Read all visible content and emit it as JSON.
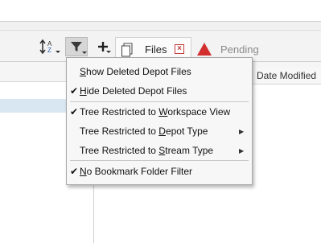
{
  "toolbar": {
    "sort_icon": "sort-az-icon",
    "filter_icon": "filter-funnel-icon",
    "add_icon": "plus-icon"
  },
  "tabs": [
    {
      "label": "Files",
      "icon": "document-icon",
      "close_icon": "close-x-icon",
      "active": true
    },
    {
      "label": "Pending",
      "icon": "warning-triangle-icon",
      "active": false
    }
  ],
  "columns": {
    "date_modified": "Date Modified"
  },
  "menu": {
    "items": [
      {
        "pre": "",
        "mnemonic": "S",
        "post": "how Deleted Depot Files",
        "checked": false,
        "submenu": false
      },
      {
        "pre": "",
        "mnemonic": "H",
        "post": "ide Deleted Depot Files",
        "checked": true,
        "submenu": false
      },
      {
        "pre": "Tree Restricted to ",
        "mnemonic": "W",
        "post": "orkspace View",
        "checked": true,
        "submenu": false
      },
      {
        "pre": "Tree Restricted to ",
        "mnemonic": "D",
        "post": "epot Type",
        "checked": false,
        "submenu": true
      },
      {
        "pre": "Tree Restricted to ",
        "mnemonic": "S",
        "post": "tream Type",
        "checked": false,
        "submenu": true
      },
      {
        "pre": "",
        "mnemonic": "N",
        "post": "o Bookmark Folder Filter",
        "checked": true,
        "submenu": false
      }
    ]
  },
  "colors": {
    "selection": "#d9e7f2",
    "close_red": "#c63b3b",
    "warning_red": "#d32f2f"
  }
}
